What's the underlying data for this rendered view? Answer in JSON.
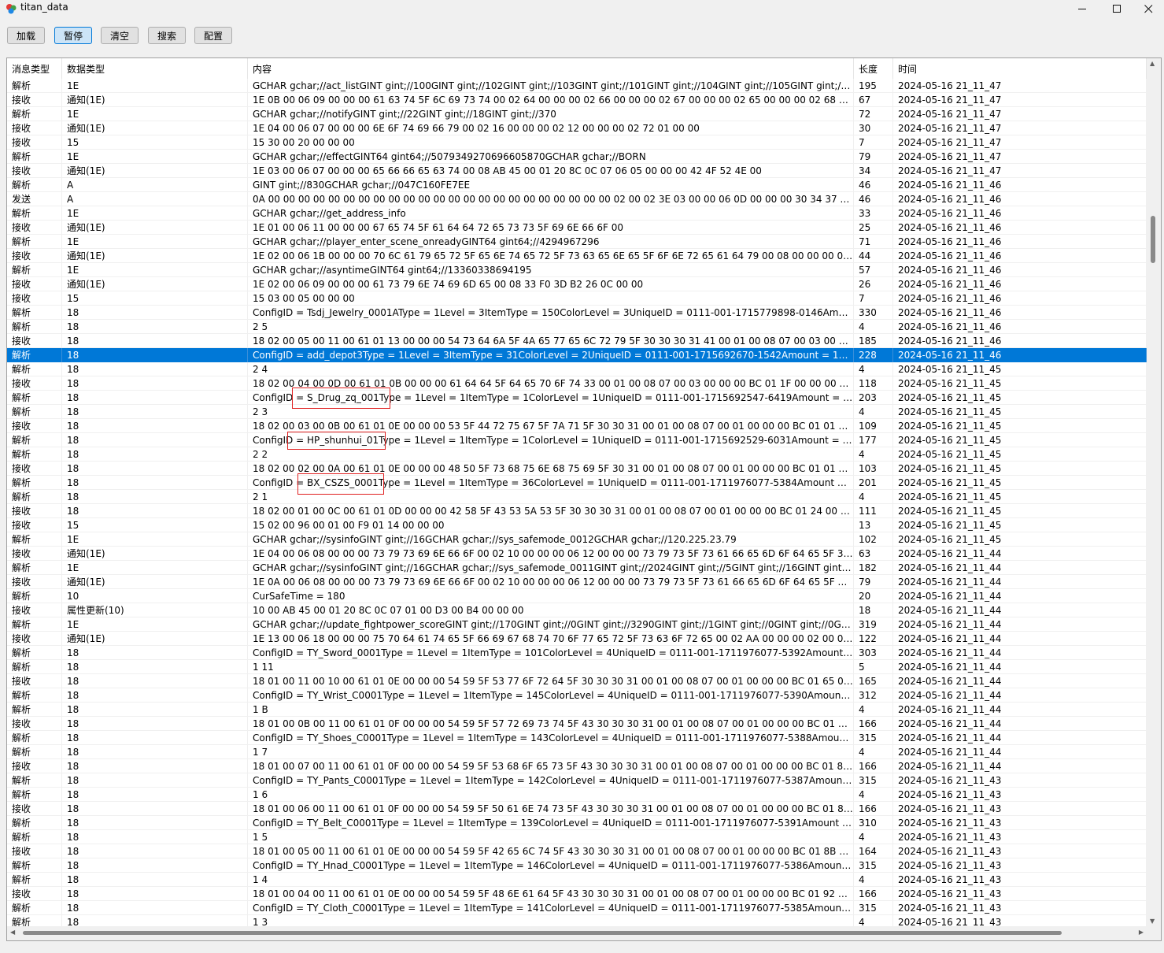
{
  "window": {
    "title": "titan_data"
  },
  "toolbar": {
    "buttons": [
      {
        "label": "加载"
      },
      {
        "label": "暂停"
      },
      {
        "label": "清空"
      },
      {
        "label": "搜索"
      },
      {
        "label": "配置"
      }
    ],
    "active_button": "暂停"
  },
  "table": {
    "columns": [
      "消息类型",
      "数据类型",
      "内容",
      "长度",
      "时间"
    ],
    "selected_row": 19,
    "rows": [
      [
        "解析",
        "1E",
        "GCHAR gchar;//act_listGINT gint;//100GINT gint;//102GINT gint;//103GINT gint;//101GINT gint;//104GINT gint;//105GINT gint;//106...",
        "195",
        "2024-05-16 21_11_47"
      ],
      [
        "接收",
        "通知(1E)",
        "1E 0B 00 06 09 00 00 00 61 63 74 5F 6C 69 73 74 00 02 64 00 00 00 02 66 00 00 00 02 67 00 00 00 02 65 00 00 00 02 68 00 00 0...",
        "67",
        "2024-05-16 21_11_47"
      ],
      [
        "解析",
        "1E",
        "GCHAR gchar;//notifyGINT gint;//22GINT gint;//18GINT gint;//370",
        "72",
        "2024-05-16 21_11_47"
      ],
      [
        "接收",
        "通知(1E)",
        "1E 04 00 06 07 00 00 00 6E 6F 74 69 66 79 00 02 16 00 00 00 02 12 00 00 00 02 72 01 00 00",
        "30",
        "2024-05-16 21_11_47"
      ],
      [
        "接收",
        "15",
        "15 30 00 20 00 00 00",
        "7",
        "2024-05-16 21_11_47"
      ],
      [
        "解析",
        "1E",
        "GCHAR gchar;//effectGINT64 gint64;//5079349270696605870GCHAR gchar;//BORN",
        "79",
        "2024-05-16 21_11_47"
      ],
      [
        "接收",
        "通知(1E)",
        "1E 03 00 06 07 00 00 00 65 66 66 65 63 74 00 08 AB 45 00 01 20 8C 0C 07 06 05 00 00 00 42 4F 52 4E 00",
        "34",
        "2024-05-16 21_11_47"
      ],
      [
        "解析",
        "A",
        "GINT gint;//830GCHAR gchar;//047C160FE7EE",
        "46",
        "2024-05-16 21_11_46"
      ],
      [
        "发送",
        "A",
        "0A 00 00 00 00 00 00 00 00 00 00 00 00 00 00 00 00 00 00 00 00 00 00 00 02 00 02 3E 03 00 00 06 0D 00 00 00 30 34 37 43 31 36 30 46 ...",
        "46",
        "2024-05-16 21_11_46"
      ],
      [
        "解析",
        "1E",
        "GCHAR gchar;//get_address_info",
        "33",
        "2024-05-16 21_11_46"
      ],
      [
        "接收",
        "通知(1E)",
        "1E 01 00 06 11 00 00 00 67 65 74 5F 61 64 64 72 65 73 73 5F 69 6E 66 6F 00",
        "25",
        "2024-05-16 21_11_46"
      ],
      [
        "解析",
        "1E",
        "GCHAR gchar;//player_enter_scene_onreadyGINT64 gint64;//4294967296",
        "71",
        "2024-05-16 21_11_46"
      ],
      [
        "接收",
        "通知(1E)",
        "1E 02 00 06 1B 00 00 00 70 6C 61 79 65 72 5F 65 6E 74 65 72 5F 73 63 65 6E 65 5F 6F 6E 72 65 61 64 79 00 08 00 00 00 00 01 0...",
        "44",
        "2024-05-16 21_11_46"
      ],
      [
        "解析",
        "1E",
        "GCHAR gchar;//asyntimeGINT64 gint64;//13360338694195",
        "57",
        "2024-05-16 21_11_46"
      ],
      [
        "接收",
        "通知(1E)",
        "1E 02 00 06 09 00 00 00 61 73 79 6E 74 69 6D 65 00 08 33 F0 3D B2 26 0C 00 00",
        "26",
        "2024-05-16 21_11_46"
      ],
      [
        "接收",
        "15",
        "15 03 00 05 00 00 00",
        "7",
        "2024-05-16 21_11_46"
      ],
      [
        "解析",
        "18",
        "ConfigID = Tsdj_Jewelry_0001AType = 1Level = 3ItemType = 150ColorLevel = 3UniqueID = 0111-001-1715779898-0146Amount = 1...",
        "330",
        "2024-05-16 21_11_46"
      ],
      [
        "解析",
        "18",
        "2 5",
        "4",
        "2024-05-16 21_11_46"
      ],
      [
        "接收",
        "18",
        "18 02 00 05 00 11 00 61 01 13 00 00 00 54 73 64 6A 5F 4A 65 77 65 6C 72 79 5F 30 30 30 31 41 00 01 00 08 07 00 03 00 00 00 B...",
        "185",
        "2024-05-16 21_11_46"
      ],
      [
        "解析",
        "18",
        "ConfigID = add_depot3Type = 1Level = 3ItemType = 31ColorLevel = 2UniqueID = 0111-001-1715692670-1542Amount = 1MaxAmou...",
        "228",
        "2024-05-16 21_11_46"
      ],
      [
        "解析",
        "18",
        "2 4",
        "4",
        "2024-05-16 21_11_45"
      ],
      [
        "接收",
        "18",
        "18 02 00 04 00 0D 00 61 01 0B 00 00 00 61 64 64 5F 64 65 70 6F 74 33 00 01 00 08 07 00 03 00 00 00 BC 01 1F 00 00 00 BD 01 0...",
        "118",
        "2024-05-16 21_11_45"
      ],
      [
        "解析",
        "18",
        "ConfigID = S_Drug_zq_001Type = 1Level = 1ItemType = 1ColorLevel = 1UniqueID = 0111-001-1715692547-6419Amount = 20MaxA...",
        "203",
        "2024-05-16 21_11_45"
      ],
      [
        "解析",
        "18",
        "2 3",
        "4",
        "2024-05-16 21_11_45"
      ],
      [
        "接收",
        "18",
        "18 02 00 03 00 0B 00 61 01 0E 00 00 00 53 5F 44 72 75 67 5F 7A 71 5F 30 30 31 00 01 00 08 07 00 01 00 00 00 BC 01 01 00 00 0...",
        "109",
        "2024-05-16 21_11_45"
      ],
      [
        "解析",
        "18",
        "ConfigID = HP_shunhui_01Type = 1Level = 1ItemType = 1ColorLevel = 1UniqueID = 0111-001-1715692529-6031Amount = 10MaxA...",
        "177",
        "2024-05-16 21_11_45"
      ],
      [
        "解析",
        "18",
        "2 2",
        "4",
        "2024-05-16 21_11_45"
      ],
      [
        "接收",
        "18",
        "18 02 00 02 00 0A 00 61 01 0E 00 00 00 48 50 5F 73 68 75 6E 68 75 69 5F 30 31 00 01 00 08 07 00 01 00 00 00 BC 01 01 00 00 0...",
        "103",
        "2024-05-16 21_11_45"
      ],
      [
        "解析",
        "18",
        "ConfigID = BX_CSZS_0001Type = 1Level = 1ItemType = 36ColorLevel = 1UniqueID = 0111-001-1711976077-5384Amount = 1MaxA...",
        "201",
        "2024-05-16 21_11_45"
      ],
      [
        "解析",
        "18",
        "2 1",
        "4",
        "2024-05-16 21_11_45"
      ],
      [
        "接收",
        "18",
        "18 02 00 01 00 0C 00 61 01 0D 00 00 00 42 58 5F 43 53 5A 53 5F 30 30 30 31 00 01 00 08 07 00 01 00 00 00 BC 01 24 00 00 00 B...",
        "111",
        "2024-05-16 21_11_45"
      ],
      [
        "接收",
        "15",
        "15 02 00 96 00 01 00 F9 01 14 00 00 00",
        "13",
        "2024-05-16 21_11_45"
      ],
      [
        "解析",
        "1E",
        "GCHAR gchar;//sysinfoGINT gint;//16GCHAR gchar;//sys_safemode_0012GCHAR gchar;//120.225.23.79",
        "102",
        "2024-05-16 21_11_45"
      ],
      [
        "接收",
        "通知(1E)",
        "1E 04 00 06 08 00 00 00 73 79 73 69 6E 66 6F 00 02 10 00 00 00 06 12 00 00 00 73 79 73 5F 73 61 66 65 6D 6F 64 65 5F 30 30 3...",
        "63",
        "2024-05-16 21_11_44"
      ],
      [
        "解析",
        "1E",
        "GCHAR gchar;//sysinfoGINT gint;//16GCHAR gchar;//sys_safemode_0011GINT gint;//2024GINT gint;//5GINT gint;//16GINT gint;//2GIN...",
        "182",
        "2024-05-16 21_11_44"
      ],
      [
        "接收",
        "通知(1E)",
        "1E 0A 00 06 08 00 00 00 73 79 73 69 6E 66 6F 00 02 10 00 00 00 06 12 00 00 00 73 79 73 5F 73 61 66 65 6D 6F 64 65 5F 30 30 3...",
        "79",
        "2024-05-16 21_11_44"
      ],
      [
        "解析",
        "10",
        "CurSafeTime = 180",
        "20",
        "2024-05-16 21_11_44"
      ],
      [
        "接收",
        "属性更新(10)",
        "10 00 AB 45 00 01 20 8C 0C 07 01 00 D3 00 B4 00 00 00",
        "18",
        "2024-05-16 21_11_44"
      ],
      [
        "解析",
        "1E",
        "GCHAR gchar;//update_fightpower_scoreGINT gint;//170GINT gint;//0GINT gint;//3290GINT gint;//1GINT gint;//0GINT gint;//0GINT g...",
        "319",
        "2024-05-16 21_11_44"
      ],
      [
        "接收",
        "通知(1E)",
        "1E 13 00 06 18 00 00 00 75 70 64 61 74 65 5F 66 69 67 68 74 70 6F 77 65 72 5F 73 63 6F 72 65 00 02 AA 00 00 00 02 00 00 00 0...",
        "122",
        "2024-05-16 21_11_44"
      ],
      [
        "解析",
        "18",
        "ConfigID = TY_Sword_0001Type = 1Level = 1ItemType = 101ColorLevel = 4UniqueID = 0111-001-1711976077-5392Amount = 1Max...",
        "303",
        "2024-05-16 21_11_44"
      ],
      [
        "解析",
        "18",
        "1 11",
        "5",
        "2024-05-16 21_11_44"
      ],
      [
        "接收",
        "18",
        "18 01 00 11 00 10 00 61 01 0E 00 00 00 54 59 5F 53 77 6F 72 64 5F 30 30 30 31 00 01 00 08 07 00 01 00 00 00 BC 01 65 00 00 0...",
        "165",
        "2024-05-16 21_11_44"
      ],
      [
        "解析",
        "18",
        "ConfigID = TY_Wrist_C0001Type = 1Level = 1ItemType = 145ColorLevel = 4UniqueID = 0111-001-1711976077-5390Amount = 1Max...",
        "312",
        "2024-05-16 21_11_44"
      ],
      [
        "解析",
        "18",
        "1 B",
        "4",
        "2024-05-16 21_11_44"
      ],
      [
        "接收",
        "18",
        "18 01 00 0B 00 11 00 61 01 0F 00 00 00 54 59 5F 57 72 69 73 74 5F 43 30 30 30 31 00 01 00 08 07 00 01 00 00 00 BC 01 91 00 0...",
        "166",
        "2024-05-16 21_11_44"
      ],
      [
        "解析",
        "18",
        "ConfigID = TY_Shoes_C0001Type = 1Level = 1ItemType = 143ColorLevel = 4UniqueID = 0111-001-1711976077-5388Amount = 1Ma...",
        "315",
        "2024-05-16 21_11_44"
      ],
      [
        "解析",
        "18",
        "1 7",
        "4",
        "2024-05-16 21_11_44"
      ],
      [
        "接收",
        "18",
        "18 01 00 07 00 11 00 61 01 0F 00 00 00 54 59 5F 53 68 6F 65 73 5F 43 30 30 30 31 00 01 00 08 07 00 01 00 00 00 BC 01 8F 00 0...",
        "166",
        "2024-05-16 21_11_44"
      ],
      [
        "解析",
        "18",
        "ConfigID = TY_Pants_C0001Type = 1Level = 1ItemType = 142ColorLevel = 4UniqueID = 0111-001-1711976077-5387Amount = 1Ma...",
        "315",
        "2024-05-16 21_11_43"
      ],
      [
        "解析",
        "18",
        "1 6",
        "4",
        "2024-05-16 21_11_43"
      ],
      [
        "接收",
        "18",
        "18 01 00 06 00 11 00 61 01 0F 00 00 00 54 59 5F 50 61 6E 74 73 5F 43 30 30 30 31 00 01 00 08 07 00 01 00 00 00 BC 01 8E 00 0...",
        "166",
        "2024-05-16 21_11_43"
      ],
      [
        "解析",
        "18",
        "ConfigID = TY_Belt_C0001Type = 1Level = 1ItemType = 139ColorLevel = 4UniqueID = 0111-001-1711976077-5391Amount = 1Max...",
        "310",
        "2024-05-16 21_11_43"
      ],
      [
        "解析",
        "18",
        "1 5",
        "4",
        "2024-05-16 21_11_43"
      ],
      [
        "接收",
        "18",
        "18 01 00 05 00 11 00 61 01 0E 00 00 00 54 59 5F 42 65 6C 74 5F 43 30 30 30 31 00 01 00 08 07 00 01 00 00 00 BC 01 8B 00 0...",
        "164",
        "2024-05-16 21_11_43"
      ],
      [
        "解析",
        "18",
        "ConfigID = TY_Hnad_C0001Type = 1Level = 1ItemType = 146ColorLevel = 4UniqueID = 0111-001-1711976077-5386Amount = 1Max...",
        "315",
        "2024-05-16 21_11_43"
      ],
      [
        "解析",
        "18",
        "1 4",
        "4",
        "2024-05-16 21_11_43"
      ],
      [
        "接收",
        "18",
        "18 01 00 04 00 11 00 61 01 0E 00 00 00 54 59 5F 48 6E 61 64 5F 43 30 30 30 31 00 01 00 08 07 00 01 00 00 00 BC 01 92 00 0...",
        "166",
        "2024-05-16 21_11_43"
      ],
      [
        "解析",
        "18",
        "ConfigID = TY_Cloth_C0001Type = 1Level = 1ItemType = 141ColorLevel = 4UniqueID = 0111-001-1711976077-5385Amount = 1Max...",
        "315",
        "2024-05-16 21_11_43"
      ],
      [
        "解析",
        "18",
        "1 3",
        "4",
        "2024-05-16 21_11_43"
      ]
    ]
  },
  "colors": {
    "selection": "#0078d7",
    "highlight_box": "#e02020",
    "active_button": "#cce4f7"
  },
  "icons": {
    "app": "app-icon",
    "minimize": "minimize-icon",
    "maximize": "maximize-icon",
    "close": "close-icon"
  }
}
